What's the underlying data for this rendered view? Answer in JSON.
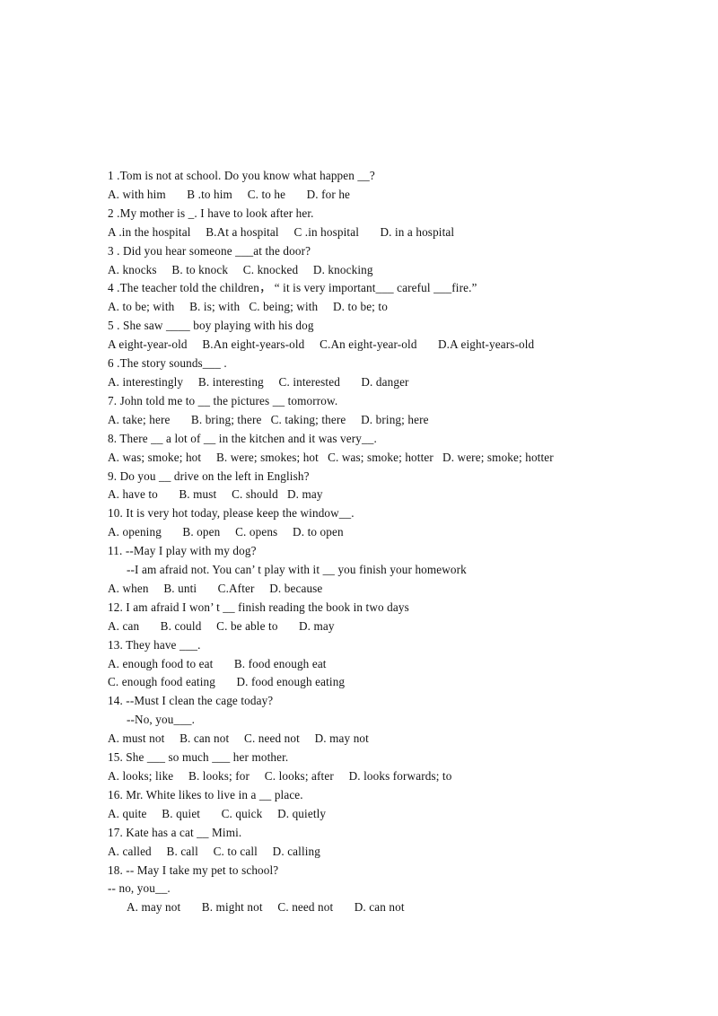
{
  "document": {
    "type": "multiple-choice-grammar-worksheet",
    "background_color": "#ffffff",
    "text_color": "#121212",
    "lines": [
      "1 .Tom is not at school. Do you know what happen __?",
      "A. with him   B .to him  C. to he   D. for he",
      "2 .My mother is _. I have to look after her.",
      "A .in the hospital  B.At a hospital  C .in hospital   D. in a hospital",
      "3 . Did you hear someone ___at the door?",
      "A. knocks  B. to knock  C. knocked  D. knocking",
      "4 .The teacher told the children， “ it is very important___ careful ___fire.”",
      "A. to be; with  B. is; with  C. being; with  D. to be; to",
      "5 . She saw ____ boy playing with his dog",
      "A eight-year-old  B.An eight-years-old  C.An eight-year-old   D.A eight-years-old",
      "6 .The story sounds___ .",
      "A. interestingly  B. interesting  C. interested   D. danger",
      "7. John told me to __ the pictures __ tomorrow.",
      "A. take; here   B. bring; there  C. taking; there  D. bring; here",
      "8. There __ a lot of __ in the kitchen and it was very__.",
      "A. was; smoke; hot  B. were; smokes; hot  C. was; smoke; hotter  D. were; smoke; hotter",
      "9. Do you __ drive on the left in English?",
      "A. have to   B. must  C. should  D. may",
      "10. It is very hot today, please keep the window__.",
      "A. opening   B. open  C. opens  D. to open",
      "11. --May I play with my dog?",
      "--I am afraid not. You can’ t play with it __ you finish your homework",
      "A. when  B. unti   C.After  D. because",
      "12. I am afraid I won’ t __ finish reading the book in two days",
      "A. can   B. could  C. be able to   D. may",
      "13. They have ___.",
      "A. enough food to eat   B. food enough eat",
      "C. enough food eating   D. food enough eating",
      "14. --Must I clean the cage today?",
      "--No, you___.",
      "A. must not  B. can not  C. need not  D. may not",
      "15. She ___ so much ___ her mother.",
      "A. looks; like  B. looks; for  C. looks; after  D. looks forwards; to",
      "16. Mr. White likes to live in a __ place.",
      "A. quite  B. quiet   C. quick  D. quietly",
      "17. Kate has a cat __ Mimi.",
      "A. called  B. call  C. to call  D. calling",
      "18. -- May I take my pet to school?",
      "-- no, you__.",
      "A. may not   B. might not  C. need not   D. can not"
    ],
    "indented_line_indices": [
      21,
      29,
      39
    ]
  }
}
